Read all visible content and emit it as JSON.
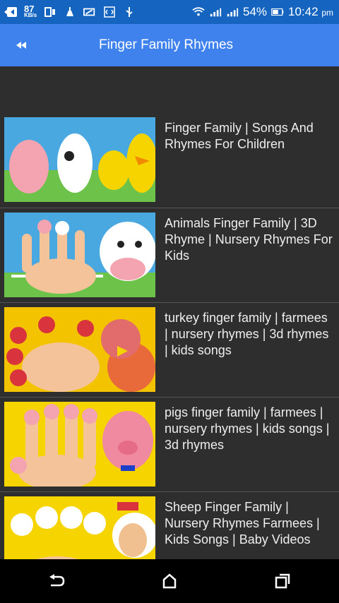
{
  "status_bar": {
    "speed": "87",
    "speed_unit": "KB/s",
    "battery": "54%",
    "time": "10:42",
    "time_suffix": "pm"
  },
  "app_bar": {
    "title": "Finger Family Rhymes",
    "back_icon": "rewind-icon"
  },
  "videos": [
    {
      "title": "Finger Family | Songs And Rhymes For Children",
      "thumb_colors": [
        "#4aa8e0",
        "#6dc34a",
        "#f4a3b0"
      ]
    },
    {
      "title": "Animals Finger Family | 3D Rhyme | Nursery Rhymes For Kids",
      "thumb_colors": [
        "#4aa8e0",
        "#6dc34a",
        "#ffffff"
      ]
    },
    {
      "title": "turkey finger family | farmees | nursery rhymes | 3d rhymes | kids songs",
      "thumb_colors": [
        "#f4c300",
        "#e86a3a",
        "#d9343e"
      ]
    },
    {
      "title": "pigs finger family | farmees | nursery rhymes | kids songs | 3d rhymes",
      "thumb_colors": [
        "#f6d400",
        "#f4a3b0",
        "#f08aa0"
      ]
    },
    {
      "title": "Sheep Finger Family | Nursery Rhymes Farmees | Kids Songs | Baby Videos",
      "thumb_colors": [
        "#f6d400",
        "#ffffff",
        "#f0c090"
      ]
    }
  ],
  "nav_bar": {
    "back_icon": "nav-back-icon",
    "home_icon": "nav-home-icon",
    "recents_icon": "nav-recents-icon"
  }
}
